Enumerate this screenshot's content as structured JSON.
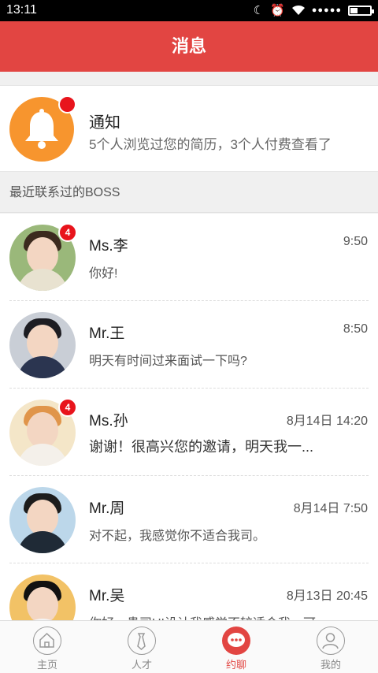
{
  "status_bar": {
    "time": "13:11",
    "signal": "●●●●●"
  },
  "header": {
    "title": "消息"
  },
  "notice": {
    "title": "通知",
    "description": "5个人浏览过您的简历，3个人付费查看了"
  },
  "section": {
    "title": "最近联系过的BOSS"
  },
  "conversations": [
    {
      "name": "Ms.李",
      "time": "9:50",
      "message": "你好!",
      "unread": "4",
      "avatar_color": "#6b8c4a"
    },
    {
      "name": "Mr.王",
      "time": "8:50",
      "message": "明天有时间过来面试一下吗?",
      "unread": "",
      "avatar_color": "#2b3550"
    },
    {
      "name": "Ms.孙",
      "time": "8月14日  14:20",
      "message": "谢谢！很高兴您的邀请，明天我一...",
      "unread": "4",
      "avatar_color": "#e9b06a"
    },
    {
      "name": "Mr.周",
      "time": "8月14日  7:50",
      "message": "对不起，我感觉你不适合我司。",
      "unread": "",
      "avatar_color": "#1f2a36"
    },
    {
      "name": "Mr.吴",
      "time": "8月13日  20:45",
      "message": "你好，贵司UI设计我感觉不较适合我，可",
      "unread": "",
      "avatar_color": "#f4f4f4"
    }
  ],
  "tabs": [
    {
      "label": "主页",
      "icon": "home-icon"
    },
    {
      "label": "人才",
      "icon": "tie-icon"
    },
    {
      "label": "约聊",
      "icon": "chat-icon",
      "active": true
    },
    {
      "label": "我的",
      "icon": "profile-icon"
    }
  ],
  "colors": {
    "brand": "#e24542",
    "badge": "#e8141c",
    "bell": "#f7952e"
  }
}
